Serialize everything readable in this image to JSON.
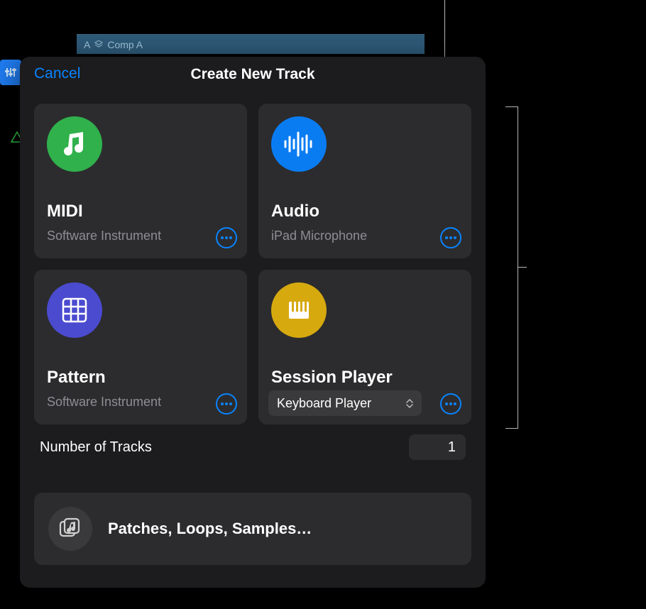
{
  "background": {
    "track_label_prefix": "A",
    "track_label": "Comp A"
  },
  "modal": {
    "cancel": "Cancel",
    "title": "Create New Track",
    "cards": {
      "midi": {
        "title": "MIDI",
        "subtitle": "Software Instrument",
        "icon_color": "#30b14c"
      },
      "audio": {
        "title": "Audio",
        "subtitle": "iPad Microphone",
        "icon_color": "#0a7cf2"
      },
      "pattern": {
        "title": "Pattern",
        "subtitle": "Software Instrument",
        "icon_color": "#4b4bd0"
      },
      "session": {
        "title": "Session Player",
        "select_value": "Keyboard Player",
        "icon_color": "#d6a90f"
      }
    },
    "tracks": {
      "label": "Number of Tracks",
      "value": "1"
    },
    "patches": {
      "label": "Patches, Loops, Samples…"
    }
  }
}
